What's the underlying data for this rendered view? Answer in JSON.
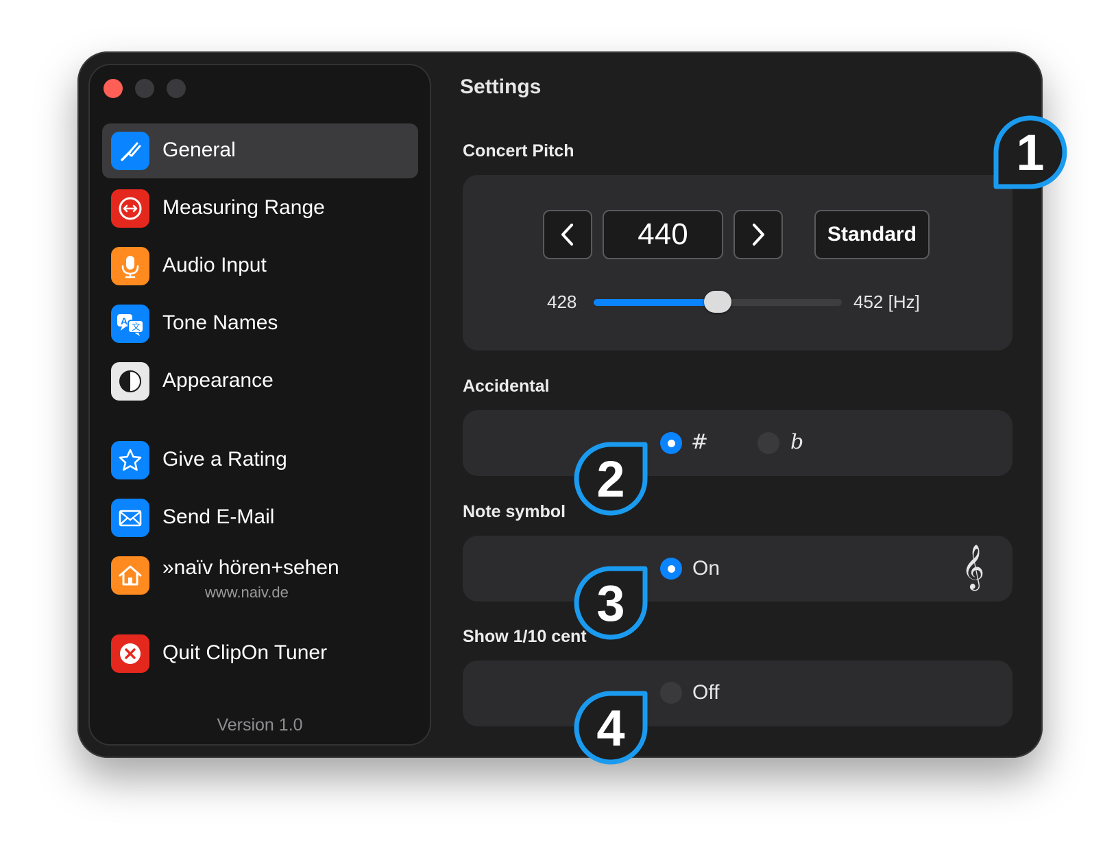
{
  "window": {
    "title": "Settings"
  },
  "sidebar": {
    "items": [
      {
        "label": "General",
        "icon": "tuning-fork-icon",
        "color": "#0a84ff",
        "selected": true
      },
      {
        "label": "Measuring Range",
        "icon": "range-arrows-icon",
        "color": "#e5281e"
      },
      {
        "label": "Audio Input",
        "icon": "microphone-icon",
        "color": "#ff8a1f"
      },
      {
        "label": "Tone Names",
        "icon": "translate-icon",
        "color": "#0a84ff"
      },
      {
        "label": "Appearance",
        "icon": "appearance-icon",
        "color": "#e8e8e8"
      },
      {
        "label": "Give a Rating",
        "icon": "star-icon",
        "color": "#0a84ff"
      },
      {
        "label": "Send E-Mail",
        "icon": "envelope-icon",
        "color": "#0a84ff"
      },
      {
        "label": "»naïv hören+sehen",
        "sublabel": "www.naiv.de",
        "icon": "house-icon",
        "color": "#ff8a1f"
      },
      {
        "label": "Quit ClipOn Tuner",
        "icon": "close-x-icon",
        "color": "#e5281e"
      }
    ],
    "version": "Version 1.0"
  },
  "concert_pitch": {
    "label": "Concert Pitch",
    "value": "440",
    "standard_label": "Standard",
    "slider": {
      "min_label": "428",
      "max_label": "452 [Hz]",
      "min": 428,
      "max": 452,
      "value": 440
    }
  },
  "accidental": {
    "label": "Accidental",
    "options": [
      {
        "label": "#",
        "selected": true
      },
      {
        "label": "b",
        "selected": false
      }
    ]
  },
  "note_symbol": {
    "label": "Note symbol",
    "state": "On",
    "enabled": true,
    "icon": "treble-clef-icon"
  },
  "tenth_cent": {
    "label": "Show 1/10 cent",
    "state": "Off",
    "enabled": false
  },
  "callouts": [
    "1",
    "2",
    "3",
    "4"
  ],
  "colors": {
    "accent": "#0a84ff",
    "callout": "#1a9bf0",
    "background": "#1e1e1e"
  }
}
